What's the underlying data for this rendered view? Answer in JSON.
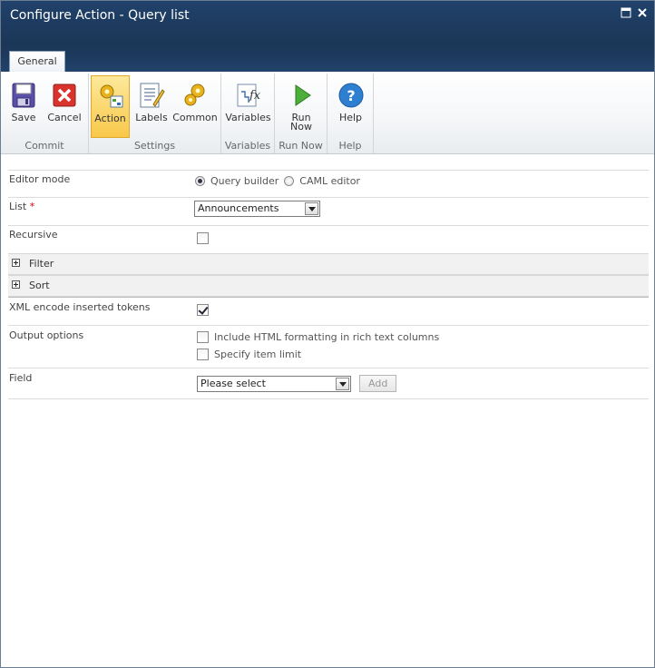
{
  "window": {
    "title": "Configure Action - Query list"
  },
  "tabs": [
    {
      "label": "General"
    }
  ],
  "ribbon": {
    "groups": [
      {
        "label": "Commit",
        "buttons": [
          {
            "label": "Save"
          },
          {
            "label": "Cancel"
          }
        ]
      },
      {
        "label": "Settings",
        "buttons": [
          {
            "label": "Action"
          },
          {
            "label": "Labels"
          },
          {
            "label": "Common"
          }
        ]
      },
      {
        "label": "Variables",
        "buttons": [
          {
            "label": "Variables"
          }
        ]
      },
      {
        "label": "Run Now",
        "buttons": [
          {
            "label_line1": "Run",
            "label_line2": "Now"
          }
        ]
      },
      {
        "label": "Help",
        "buttons": [
          {
            "label": "Help"
          }
        ]
      }
    ],
    "active_button": "Action"
  },
  "form": {
    "editor_mode": {
      "label": "Editor mode",
      "options": [
        {
          "label": "Query builder",
          "checked": true
        },
        {
          "label": "CAML editor",
          "checked": false
        }
      ]
    },
    "list": {
      "label": "List",
      "required_marker": "*",
      "selected": "Announcements"
    },
    "recursive": {
      "label": "Recursive",
      "checked": false
    },
    "filter_section": {
      "label": "Filter"
    },
    "sort_section": {
      "label": "Sort"
    },
    "xml_encode": {
      "label": "XML encode inserted tokens",
      "checked": true
    },
    "output_options": {
      "label": "Output options",
      "options": [
        {
          "label": "Include HTML formatting in rich text columns",
          "checked": false
        },
        {
          "label": "Specify item limit",
          "checked": false
        }
      ]
    },
    "field": {
      "label": "Field",
      "selected": "Please select",
      "add_label": "Add"
    }
  },
  "colors": {
    "titlebar": "#1e3c61",
    "active_button": "#f8c84a",
    "required": "#cc0000"
  }
}
